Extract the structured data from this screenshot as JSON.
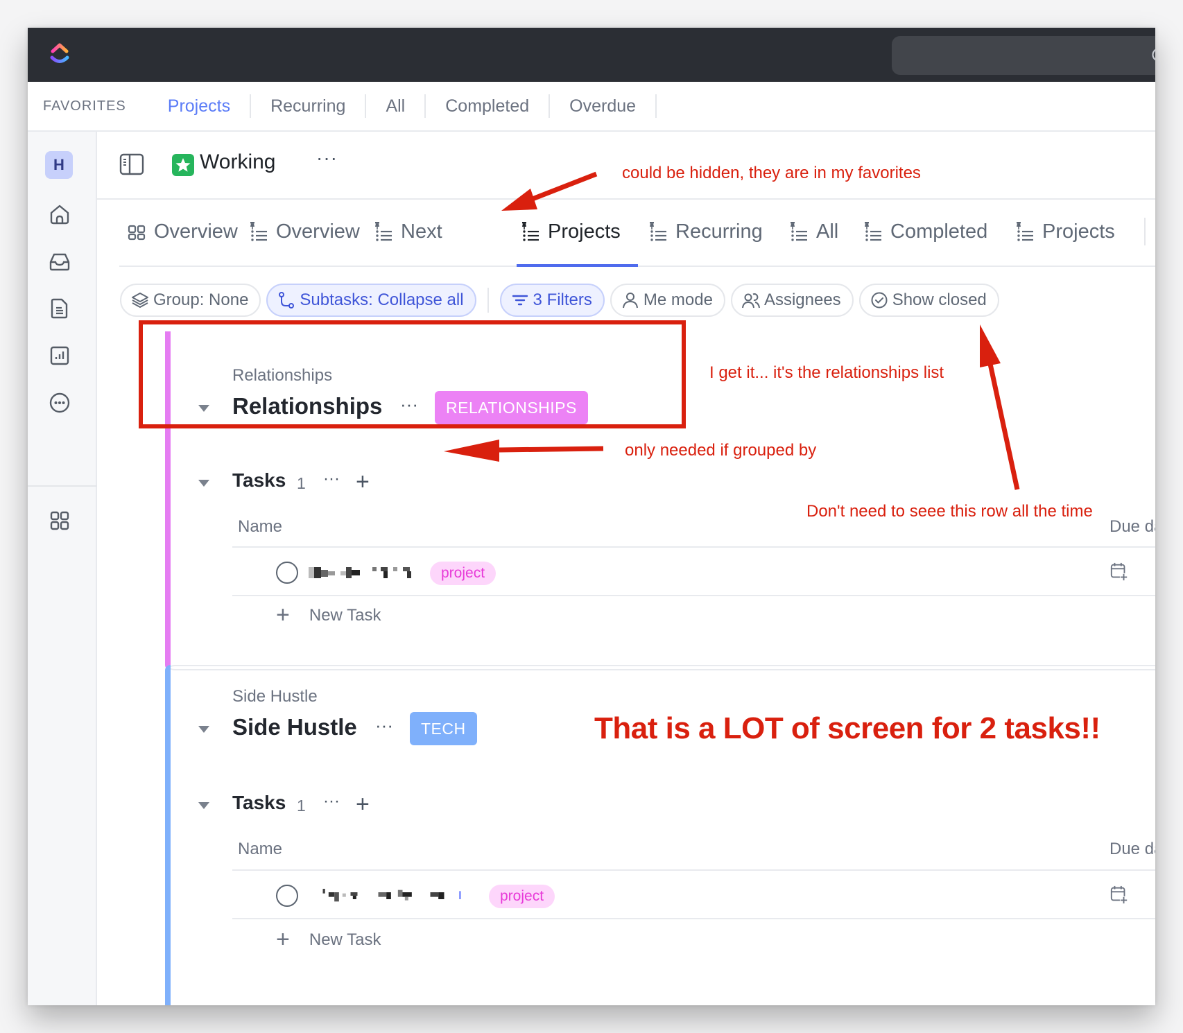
{
  "topbar": {
    "logo_icon": "clickup-logo-icon",
    "search_icon": "search-icon"
  },
  "favorites": {
    "label": "FAVORITES",
    "items": [
      {
        "label": "Projects",
        "active": true
      },
      {
        "label": "Recurring",
        "active": false
      },
      {
        "label": "All",
        "active": false
      },
      {
        "label": "Completed",
        "active": false
      },
      {
        "label": "Overdue",
        "active": false
      }
    ]
  },
  "sidebar": {
    "avatar_letter": "H",
    "avatar_color": "#c7d0fb",
    "icons": [
      "home-icon",
      "inbox-icon",
      "docs-icon",
      "dashboards-icon",
      "more-icon",
      "apps-icon"
    ]
  },
  "header": {
    "space_name": "Working",
    "space_color": "#26b55c",
    "more": "···"
  },
  "view_tabs": [
    {
      "label": "Overview",
      "icon": "grid-icon",
      "pinned": false,
      "active": false
    },
    {
      "label": "Overview",
      "icon": "list-icon",
      "pinned": true,
      "active": false
    },
    {
      "label": "Next",
      "icon": "list-icon",
      "pinned": true,
      "active": false
    },
    {
      "label": "Projects",
      "icon": "list-icon",
      "pinned": true,
      "active": true
    },
    {
      "label": "Recurring",
      "icon": "list-icon",
      "pinned": true,
      "active": false
    },
    {
      "label": "All",
      "icon": "list-icon",
      "pinned": true,
      "active": false
    },
    {
      "label": "Completed",
      "icon": "list-icon",
      "pinned": true,
      "active": false
    },
    {
      "label": "Projects",
      "icon": "list-icon",
      "pinned": true,
      "active": false
    }
  ],
  "add_view": "+",
  "accent_color": "#4f6bed",
  "filters": [
    {
      "label": "Group: None",
      "icon": "layers-icon",
      "active": false
    },
    {
      "label": "Subtasks: Collapse all",
      "icon": "subtasks-icon",
      "active": true
    },
    {
      "label": "3 Filters",
      "icon": "filter-icon",
      "active": true
    },
    {
      "label": "Me mode",
      "icon": "user-icon",
      "active": false
    },
    {
      "label": "Assignees",
      "icon": "users-icon",
      "active": false
    },
    {
      "label": "Show closed",
      "icon": "check-circle-icon",
      "active": false
    }
  ],
  "groups": [
    {
      "parent": "Relationships",
      "title": "Relationships",
      "more": "···",
      "tag": "RELATIONSHIPS",
      "tag_color": "#ec82f5",
      "bar_color": "#e57cf2",
      "task_group": {
        "title": "Tasks",
        "count": "1",
        "more": "···",
        "add": "+"
      },
      "columns": {
        "name": "Name",
        "due": "Due date"
      },
      "tasks": [
        {
          "name": "(redacted)",
          "tag": "project"
        }
      ],
      "new_task": "New Task"
    },
    {
      "parent": "Side Hustle",
      "title": "Side Hustle",
      "more": "···",
      "tag": "TECH",
      "tag_color": "#7fb0fb",
      "bar_color": "#7fb0fb",
      "task_group": {
        "title": "Tasks",
        "count": "1",
        "more": "···",
        "add": "+"
      },
      "columns": {
        "name": "Name",
        "due": "Due date"
      },
      "tasks": [
        {
          "name": "(redacted)",
          "tag": "project"
        }
      ],
      "new_task": "New Task"
    }
  ],
  "annotations": {
    "color": "#d9200e",
    "favorites_note": "could be hidden, they are in my favorites",
    "relationships_note": "I get it... it's the relationships list",
    "grouped_note": "only needed if grouped by",
    "row_note": "Don't need to seee this row all the time",
    "headline": "That is a LOT of screen for 2 tasks!!"
  }
}
